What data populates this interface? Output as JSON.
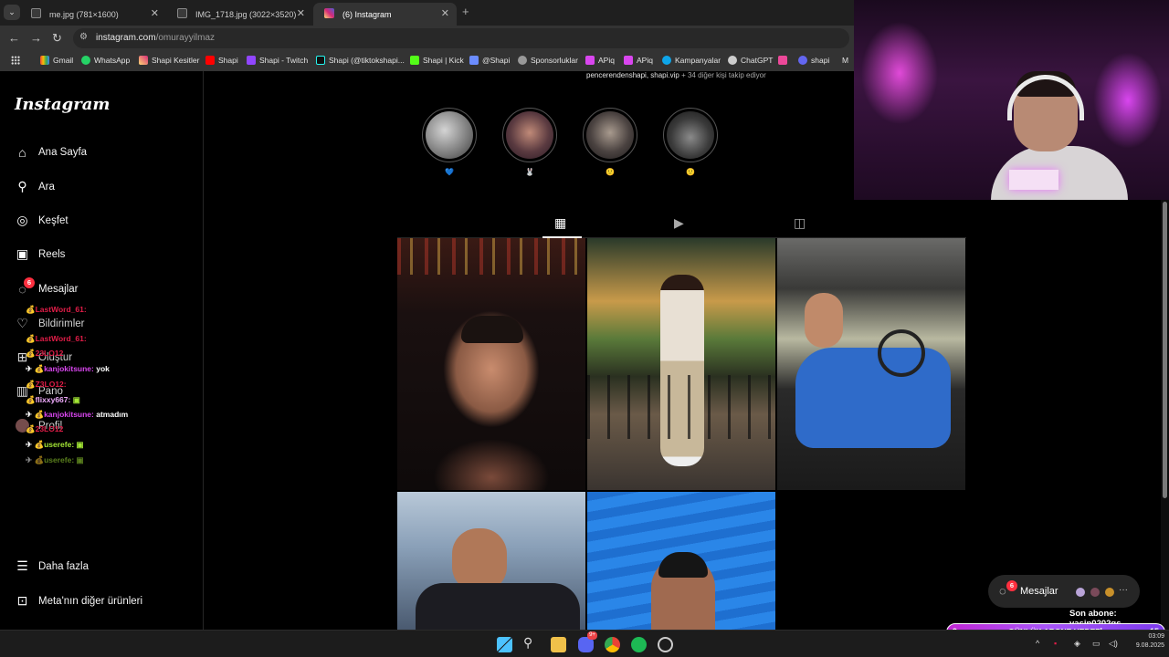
{
  "browser": {
    "tabs": [
      {
        "title": "me.jpg (781×1600)",
        "active": false
      },
      {
        "title": "IMG_1718.jpg (3022×3520)",
        "active": false
      },
      {
        "title": "(6) Instagram",
        "active": true
      }
    ],
    "url_host": "instagram.com",
    "url_path": "/omurayyilmaz",
    "bookmarks": [
      "Gmail",
      "WhatsApp",
      "Shapi Kesitler",
      "Shapi",
      "Shapi - Twitch",
      "Shapi (@tiktokshapi...",
      "Shapi | Kick",
      "@Shapi",
      "Sponsorluklar",
      "APiq",
      "APiq",
      "Kampanyalar",
      "ChatGPT",
      "shapi",
      "M"
    ]
  },
  "instagram": {
    "logo": "Instagram",
    "nav": {
      "home": "Ana Sayfa",
      "search": "Ara",
      "explore": "Keşfet",
      "reels": "Reels",
      "messages": "Mesajlar",
      "notifications": "Bildirimler",
      "create": "Oluştur",
      "dashboard": "Pano",
      "profile": "Profil",
      "more": "Daha fazla",
      "meta": "Meta'nın diğer ürünleri"
    },
    "messages_badge": "6",
    "followed_by_names": "pencerendenshapi, shapi.vip",
    "followed_by_rest": " + 34 diğer kişi takip ediyor",
    "highlights": [
      "💙",
      "🐰",
      "🙂",
      "🙂"
    ],
    "profile_tabs": [
      "grid-icon",
      "reels-icon",
      "tagged-icon"
    ],
    "messages_pill": {
      "label": "Mesajlar",
      "badge": "6"
    }
  },
  "chat": [
    {
      "user": "LastWord_61:",
      "text": ""
    },
    {
      "user": "LastWord_61:",
      "text": ""
    },
    {
      "user": "23LO12",
      "text": ""
    },
    {
      "user": "kanjokitsune:",
      "text": "yok"
    },
    {
      "user": "Z3LO12:",
      "text": ""
    },
    {
      "user": "flixxy667:",
      "text": ""
    },
    {
      "user": "kanjokitsune:",
      "text": "atmadım"
    },
    {
      "user": "23LO12",
      "text": ""
    },
    {
      "user": "userefe:",
      "text": ""
    },
    {
      "user": "userefe:",
      "text": ""
    }
  ],
  "stream": {
    "last_sub": "Son abone: yasin0202gs",
    "goal_current": "9",
    "goal_label": "GÜNLÜK ABONE HEDEFİ",
    "goal_target": "15"
  },
  "taskbar": {
    "time": "03:09",
    "date": "9.08.2025",
    "discord_badge": "9+"
  },
  "colors": {
    "ig_bg": "#000000",
    "badge_red": "#ff3040",
    "goal_purple": "#a855f7"
  }
}
